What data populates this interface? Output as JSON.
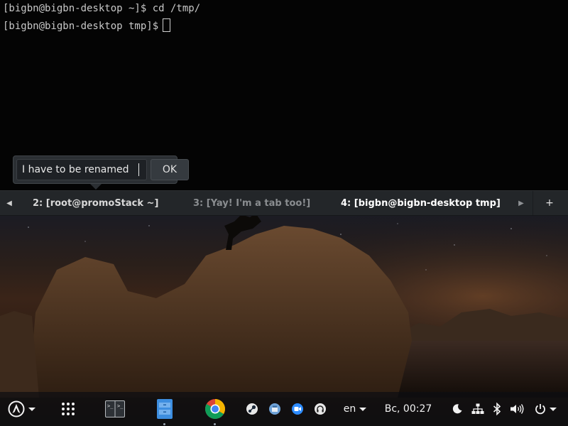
{
  "terminal": {
    "line1": "[bigbn@bigbn-desktop ~]$ cd /tmp/",
    "line2": "[bigbn@bigbn-desktop tmp]$"
  },
  "rename_dialog": {
    "input_value": "I have to be renamed",
    "ok_label": "OK"
  },
  "tabs": [
    {
      "label": "2: [root@promoStack  ~]",
      "state": "normal"
    },
    {
      "label": "3: [Yay! I'm a tab too!]",
      "state": "dimmed"
    },
    {
      "label": "4: [bigbn@bigbn-desktop tmp]",
      "state": "active"
    }
  ],
  "tabbar": {
    "scroll_left_icon": "triangle-left-icon",
    "scroll_right_icon": "triangle-right-icon",
    "new_tab_label": "+"
  },
  "panel": {
    "launchers": [
      {
        "name": "arch-menu-icon"
      },
      {
        "name": "app-grid-icon"
      },
      {
        "name": "terminal-app-icon"
      },
      {
        "name": "file-manager-icon"
      },
      {
        "name": "chrome-icon"
      },
      {
        "name": "steam-icon"
      },
      {
        "name": "store-icon"
      },
      {
        "name": "video-call-icon"
      },
      {
        "name": "headphones-icon"
      }
    ],
    "language": "en",
    "clock": "Вс, 00:27",
    "tray": [
      "moon-icon",
      "network-icon",
      "bluetooth-icon",
      "volume-icon",
      "power-icon"
    ]
  },
  "colors": {
    "terminal_bg": "#040404",
    "tabbar_bg": "#232629",
    "panel_bg": "#0c0e12"
  }
}
